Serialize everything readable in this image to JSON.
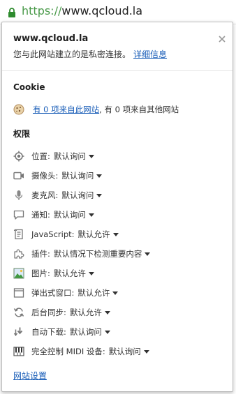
{
  "omnibox": {
    "scheme": "https://",
    "host": "www.qcloud.la",
    "lock_color": "#2e8b2e"
  },
  "popup": {
    "site_title": "www.qcloud.la",
    "description": "您与此网站建立的是私密连接。",
    "detail_link": "详细信息",
    "close_icon": "close-icon"
  },
  "cookie": {
    "title": "Cookie",
    "link": "有 0 项来自此网站",
    "rest": ", 有 0 项来自其他网站"
  },
  "permissions": {
    "title": "权限",
    "separator": ":",
    "items": [
      {
        "icon": "location-icon",
        "label": "位置",
        "value": "默认询问"
      },
      {
        "icon": "camera-icon",
        "label": "摄像头",
        "value": "默认询问"
      },
      {
        "icon": "microphone-icon",
        "label": "麦克风",
        "value": "默认询问"
      },
      {
        "icon": "notification-icon",
        "label": "通知",
        "value": "默认询问"
      },
      {
        "icon": "javascript-icon",
        "label": "JavaScript",
        "value": "默认允许"
      },
      {
        "icon": "plugin-icon",
        "label": "插件",
        "value": "默认情况下检测重要内容"
      },
      {
        "icon": "image-icon",
        "label": "图片",
        "value": "默认允许"
      },
      {
        "icon": "popup-icon",
        "label": "弹出式窗口",
        "value": "默认允许"
      },
      {
        "icon": "sync-icon",
        "label": "后台同步",
        "value": "默认允许"
      },
      {
        "icon": "download-icon",
        "label": "自动下载",
        "value": "默认询问"
      },
      {
        "icon": "midi-icon",
        "label": "完全控制 MIDI 设备",
        "value": "默认询问"
      }
    ]
  },
  "footer": {
    "settings_link": "网站设置"
  }
}
